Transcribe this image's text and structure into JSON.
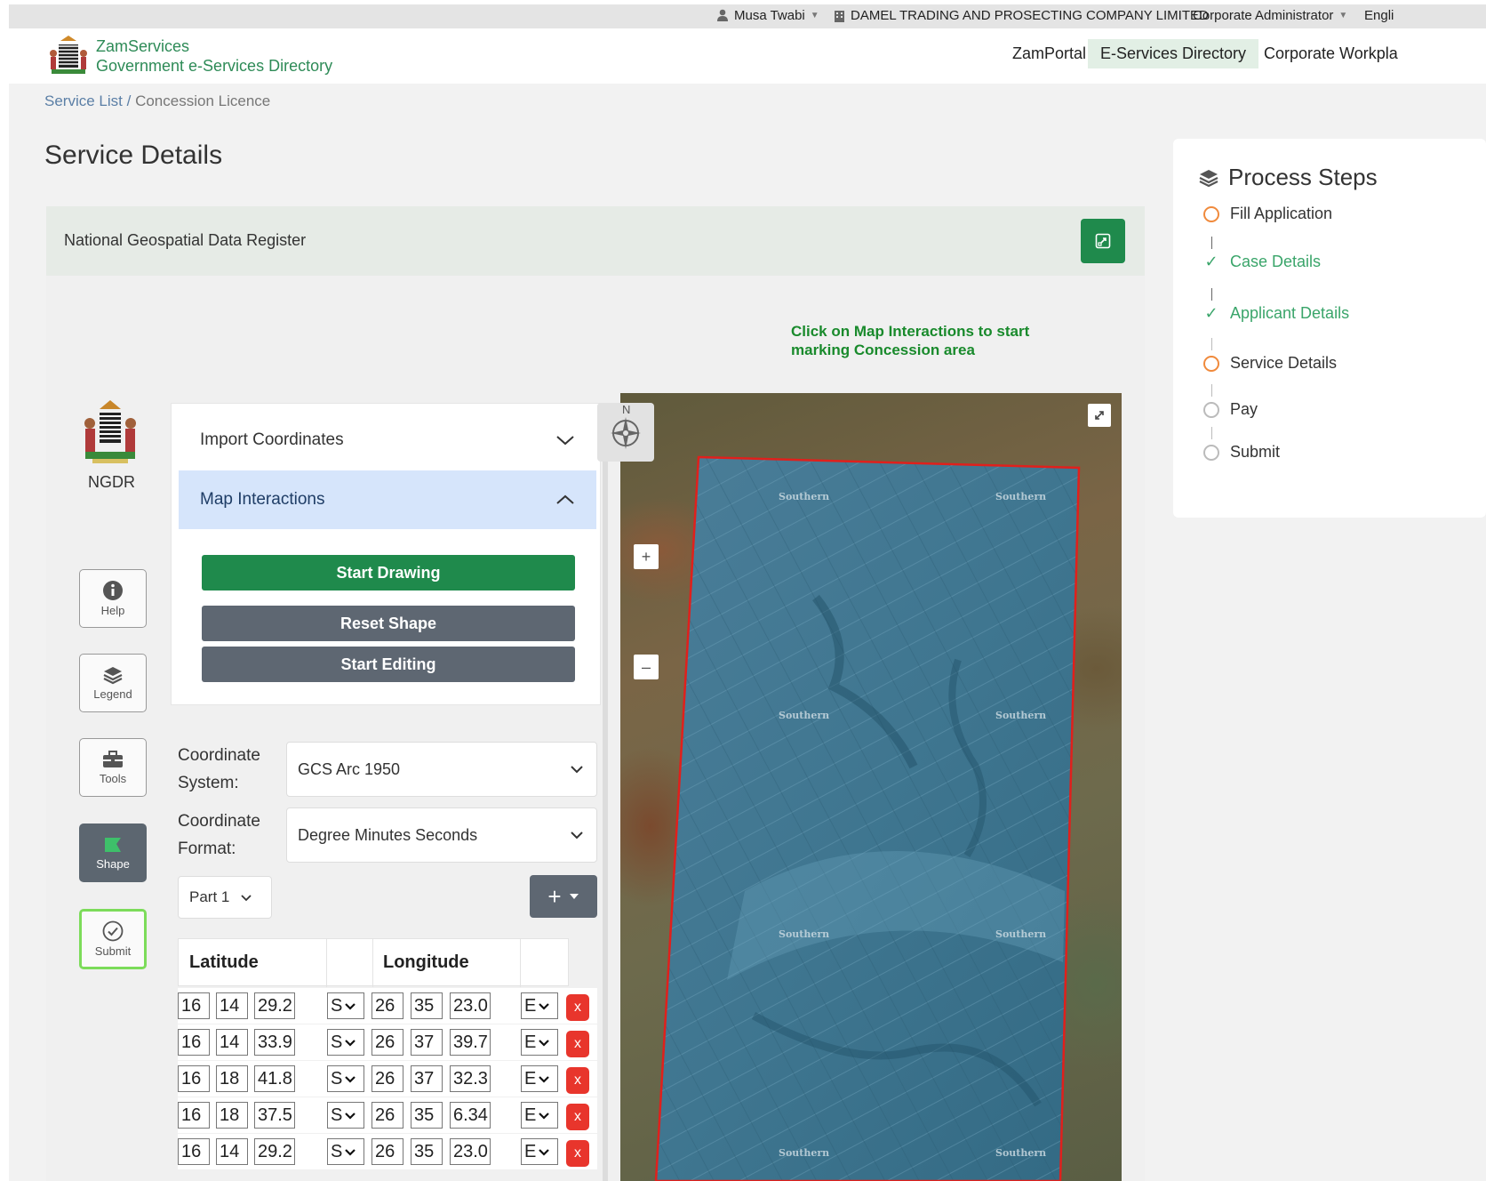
{
  "topbar": {
    "user": "Musa Twabi",
    "company": "DAMEL TRADING AND PROSECTING COMPANY LIMITED",
    "role": "Corporate Administrator",
    "language": "Engli"
  },
  "header": {
    "brand_title": "ZamServices",
    "brand_subtitle": "Government e-Services Directory",
    "nav": [
      "ZamPortal",
      "E-Services Directory",
      "Corporate Workpla"
    ]
  },
  "breadcrumb": {
    "root": "Service List",
    "separator": "/",
    "current": "Concession Licence"
  },
  "page_title": "Service Details",
  "panel": {
    "title": "National Geospatial Data Register"
  },
  "map_hint": "Click on Map Interactions to start marking Concession area",
  "ngdr_label": "NGDR",
  "sidebar": [
    "Help",
    "Legend",
    "Tools",
    "Shape",
    "Submit"
  ],
  "accordion": {
    "import_label": "Import Coordinates",
    "map_label": "Map Interactions",
    "buttons": [
      "Start Drawing",
      "Reset Shape",
      "Start Editing"
    ]
  },
  "coord_system": {
    "label_line1": "Coordinate",
    "label_line2": "System:",
    "value": "GCS Arc 1950"
  },
  "coord_format": {
    "label_line1": "Coordinate",
    "label_line2": "Format:",
    "value": "Degree Minutes Seconds"
  },
  "part_select": "Part 1",
  "add_button": "+",
  "table": {
    "headers": [
      "Latitude",
      "Longitude"
    ],
    "rows": [
      [
        "16",
        "14",
        "29.2",
        "S",
        "26",
        "35",
        "23.0",
        "E"
      ],
      [
        "16",
        "14",
        "33.9",
        "S",
        "26",
        "37",
        "39.7",
        "E"
      ],
      [
        "16",
        "18",
        "41.8",
        "S",
        "26",
        "37",
        "32.3",
        "E"
      ],
      [
        "16",
        "18",
        "37.5",
        "S",
        "26",
        "35",
        "6.34",
        "E"
      ],
      [
        "16",
        "14",
        "29.2",
        "S",
        "26",
        "35",
        "23.0",
        "E"
      ]
    ],
    "delete_label": "x"
  },
  "map": {
    "compass_label": "N",
    "zoom_in": "+",
    "zoom_out": "–",
    "region_label": "Southern",
    "polygon_color": "#e0201c"
  },
  "process_steps": {
    "title": "Process Steps",
    "steps": [
      {
        "label": "Fill Application",
        "state": "current"
      },
      {
        "label": "Case Details",
        "state": "done"
      },
      {
        "label": "Applicant Details",
        "state": "done"
      },
      {
        "label": "Service Details",
        "state": "current"
      },
      {
        "label": "Pay",
        "state": "pending"
      },
      {
        "label": "Submit",
        "state": "pending"
      }
    ]
  },
  "colors": {
    "brand_green": "#1f8a4c",
    "accent_orange": "#f08a3c",
    "hint_green": "#198a2c"
  }
}
